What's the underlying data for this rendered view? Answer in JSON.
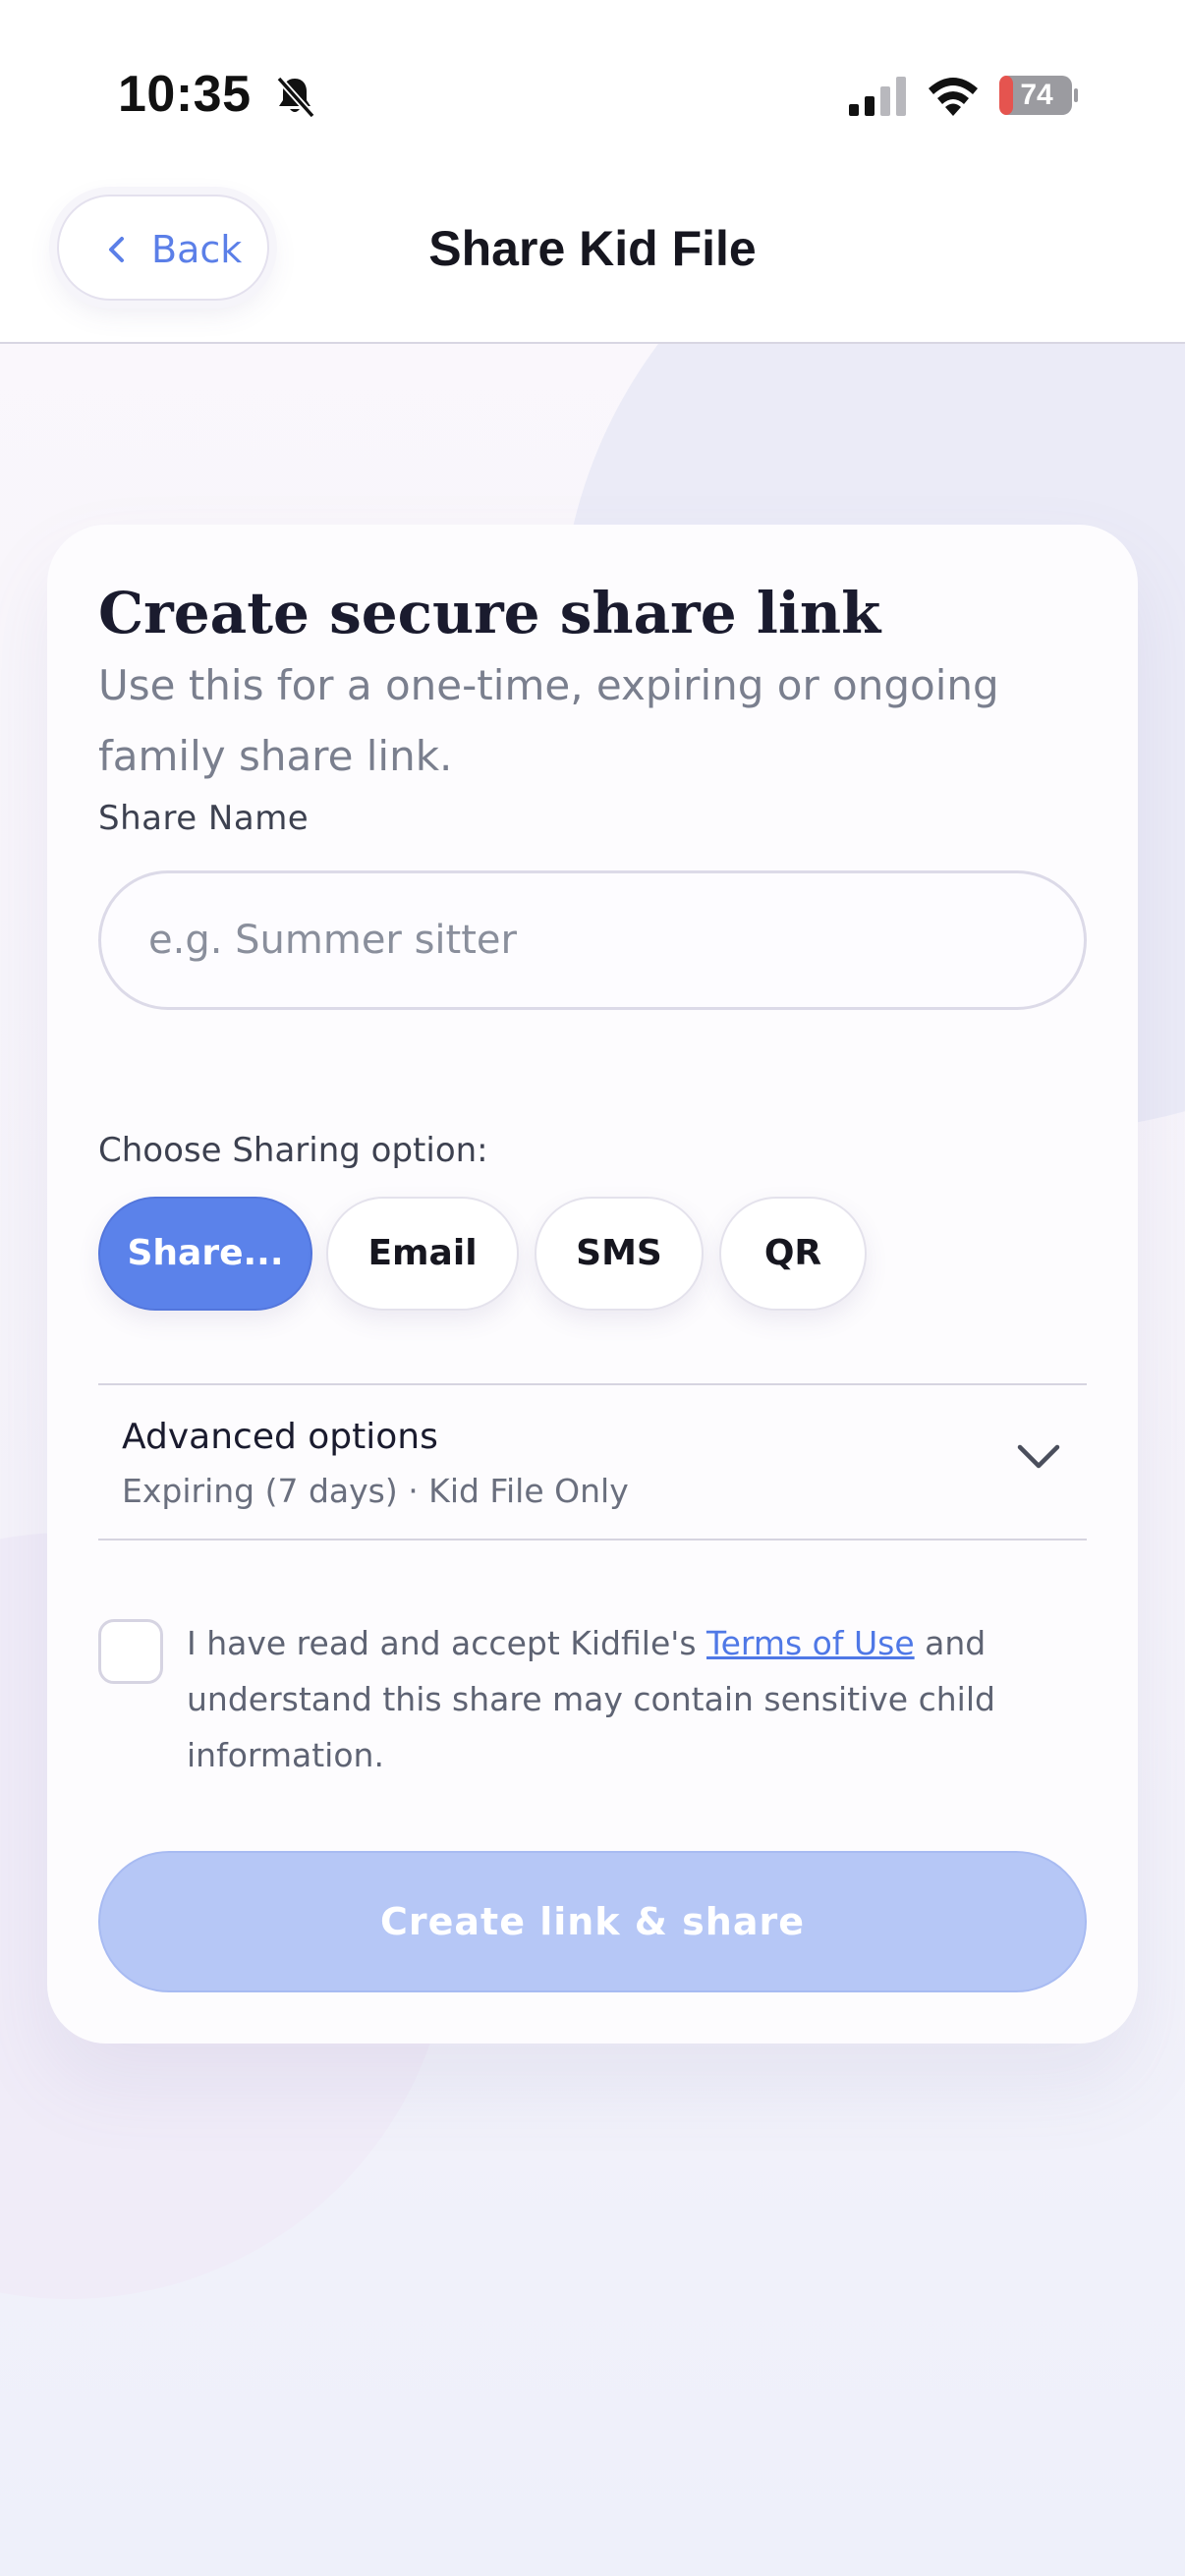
{
  "status_bar": {
    "time": "10:35",
    "battery": "74",
    "icons": [
      "bell-slash-icon",
      "cellular-signal-icon",
      "wifi-icon",
      "battery-charging-icon"
    ]
  },
  "header": {
    "back_label": "Back",
    "title": "Share Kid File"
  },
  "card": {
    "title": "Create secure share link",
    "subtitle": "Use this for a one-time, expiring or ongoing family share link.",
    "share_name": {
      "label": "Share Name",
      "placeholder": "e.g. Summer sitter",
      "value": ""
    },
    "sharing": {
      "label": "Choose Sharing option:",
      "options": [
        "Share...",
        "Email",
        "SMS",
        "QR"
      ],
      "selected": "Share..."
    },
    "advanced": {
      "title": "Advanced options",
      "summary": "Expiring (7 days) · Kid File Only"
    },
    "terms": {
      "checked": false,
      "text_before": "I have read and accept Kidfile's ",
      "link_text": "Terms of Use",
      "text_after": " and understand this share may contain sensitive child information."
    },
    "submit_label": "Create link & share"
  },
  "colors": {
    "accent": "#5b82ea",
    "accent_disabled": "#b6c7f6",
    "link": "#4f78e6",
    "title_text": "#1a1b2e",
    "battery_low": "#e5544f"
  }
}
